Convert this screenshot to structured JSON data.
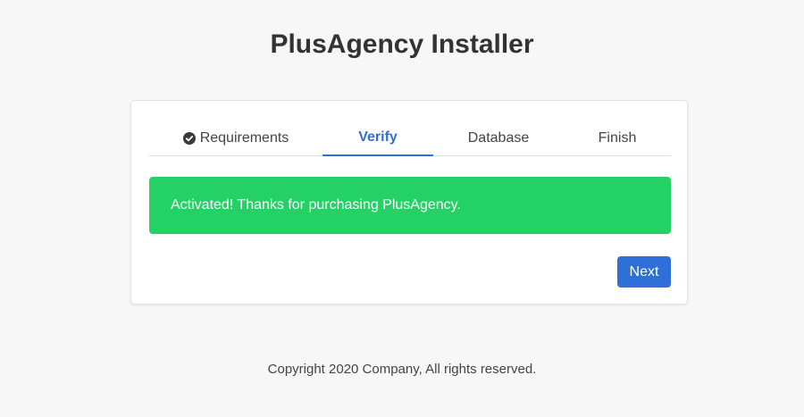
{
  "header": {
    "title": "PlusAgency Installer"
  },
  "tabs": [
    {
      "label": "Requirements",
      "icon": "check-circle-icon",
      "completed": true
    },
    {
      "label": "Verify",
      "active": true
    },
    {
      "label": "Database"
    },
    {
      "label": "Finish"
    }
  ],
  "alert": {
    "message": "Activated! Thanks for purchasing PlusAgency.",
    "color": "#24d164"
  },
  "actions": {
    "next_label": "Next"
  },
  "footer": {
    "copyright": "Copyright 2020 Company, All rights reserved."
  },
  "colors": {
    "accent": "#2e6fd8",
    "success": "#24d164",
    "background": "#f7f7f7"
  }
}
